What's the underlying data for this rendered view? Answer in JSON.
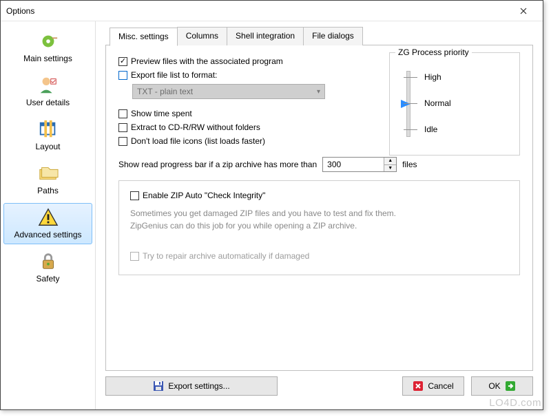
{
  "window": {
    "title": "Options"
  },
  "sidebar": {
    "items": [
      {
        "label": "Main settings"
      },
      {
        "label": "User details"
      },
      {
        "label": "Layout"
      },
      {
        "label": "Paths"
      },
      {
        "label": "Advanced settings"
      },
      {
        "label": "Safety"
      }
    ]
  },
  "tabs": [
    {
      "label": "Misc. settings"
    },
    {
      "label": "Columns"
    },
    {
      "label": "Shell integration"
    },
    {
      "label": "File dialogs"
    }
  ],
  "misc": {
    "preview_files": {
      "label": "Preview files with the associated program",
      "checked": true
    },
    "export_filelist": {
      "label": "Export file list to format:",
      "checked": false
    },
    "format_combo": "TXT - plain text",
    "show_time": {
      "label": "Show time spent",
      "checked": false
    },
    "extract_cd": {
      "label": "Extract to CD-R/RW without folders",
      "checked": false
    },
    "no_icons": {
      "label": "Don't load file icons (list loads faster)",
      "checked": false
    },
    "progress_label_pre": "Show read progress bar if a zip archive has more than",
    "progress_value": "300",
    "progress_label_post": "files"
  },
  "priority": {
    "legend": "ZG Process priority",
    "levels": [
      "High",
      "Normal",
      "Idle"
    ],
    "selected": "Normal"
  },
  "integrity": {
    "enable": {
      "label": "Enable ZIP Auto \"Check Integrity\"",
      "checked": false
    },
    "desc_line1": "Sometimes you get damaged ZIP files and you have to test and fix them.",
    "desc_line2": "ZipGenius can do this job for you while opening a ZIP archive.",
    "autorepair": {
      "label": "Try to repair archive automatically if damaged",
      "checked": false
    }
  },
  "buttons": {
    "export": "Export settings...",
    "cancel": "Cancel",
    "ok": "OK"
  },
  "watermark": "LO4D.com"
}
